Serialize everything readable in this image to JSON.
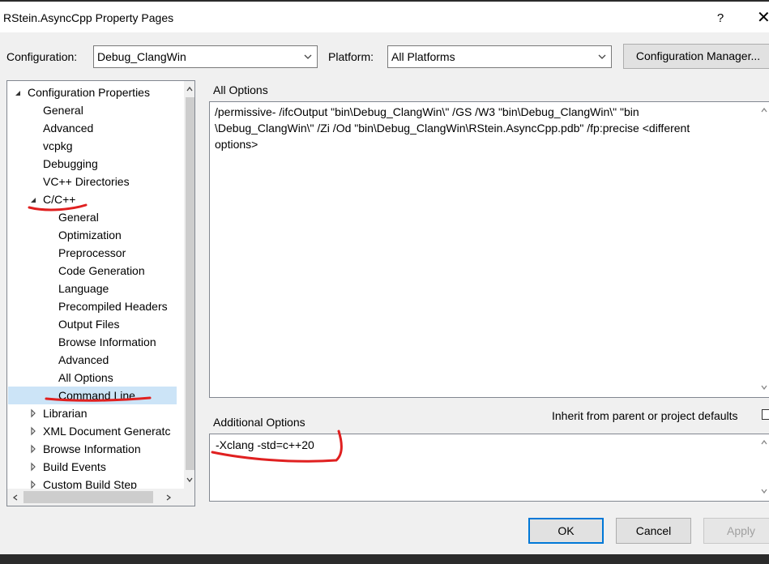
{
  "window": {
    "title": "RStein.AsyncCpp Property Pages",
    "help_label": "?",
    "close_label": "✕"
  },
  "config": {
    "configuration_label": "Configuration:",
    "configuration_value": "Debug_ClangWin",
    "platform_label": "Platform:",
    "platform_value": "All Platforms",
    "manager_button": "Configuration Manager..."
  },
  "tree": {
    "items": [
      {
        "label": "Configuration Properties",
        "expander": "expanded"
      },
      {
        "label": "General"
      },
      {
        "label": "Advanced"
      },
      {
        "label": "vcpkg"
      },
      {
        "label": "Debugging"
      },
      {
        "label": "VC++ Directories"
      },
      {
        "label": "C/C++",
        "expander": "expanded"
      },
      {
        "label": "General"
      },
      {
        "label": "Optimization"
      },
      {
        "label": "Preprocessor"
      },
      {
        "label": "Code Generation"
      },
      {
        "label": "Language"
      },
      {
        "label": "Precompiled Headers"
      },
      {
        "label": "Output Files"
      },
      {
        "label": "Browse Information"
      },
      {
        "label": "Advanced"
      },
      {
        "label": "All Options"
      },
      {
        "label": "Command Line",
        "selected": true
      },
      {
        "label": "Librarian",
        "expander": "collapsed"
      },
      {
        "label": "XML Document Generatc",
        "expander": "collapsed"
      },
      {
        "label": "Browse Information",
        "expander": "collapsed"
      },
      {
        "label": "Build Events",
        "expander": "collapsed"
      },
      {
        "label": "Custom Build Step",
        "expander": "collapsed"
      }
    ]
  },
  "all_options": {
    "label": "All Options",
    "text": "/permissive- /ifcOutput \"bin\\Debug_ClangWin\\\" /GS /W3 \"bin\\Debug_ClangWin\\\" \"bin\n\\Debug_ClangWin\\\" /Zi /Od \"bin\\Debug_ClangWin\\RStein.AsyncCpp.pdb\" /fp:precise <different\noptions>"
  },
  "additional_options": {
    "label": "Additional Options",
    "inherit_label": "Inherit from parent or project defaults",
    "inherit_checked": false,
    "text": "-Xclang -std=c++20"
  },
  "buttons": {
    "ok": "OK",
    "cancel": "Cancel",
    "apply": "Apply"
  },
  "annotations": {
    "stroke_color": "#e02020"
  },
  "colors": {
    "selection": "#cce4f7",
    "ok_border": "#0078d7",
    "disabled_text": "#a0a0a0"
  }
}
